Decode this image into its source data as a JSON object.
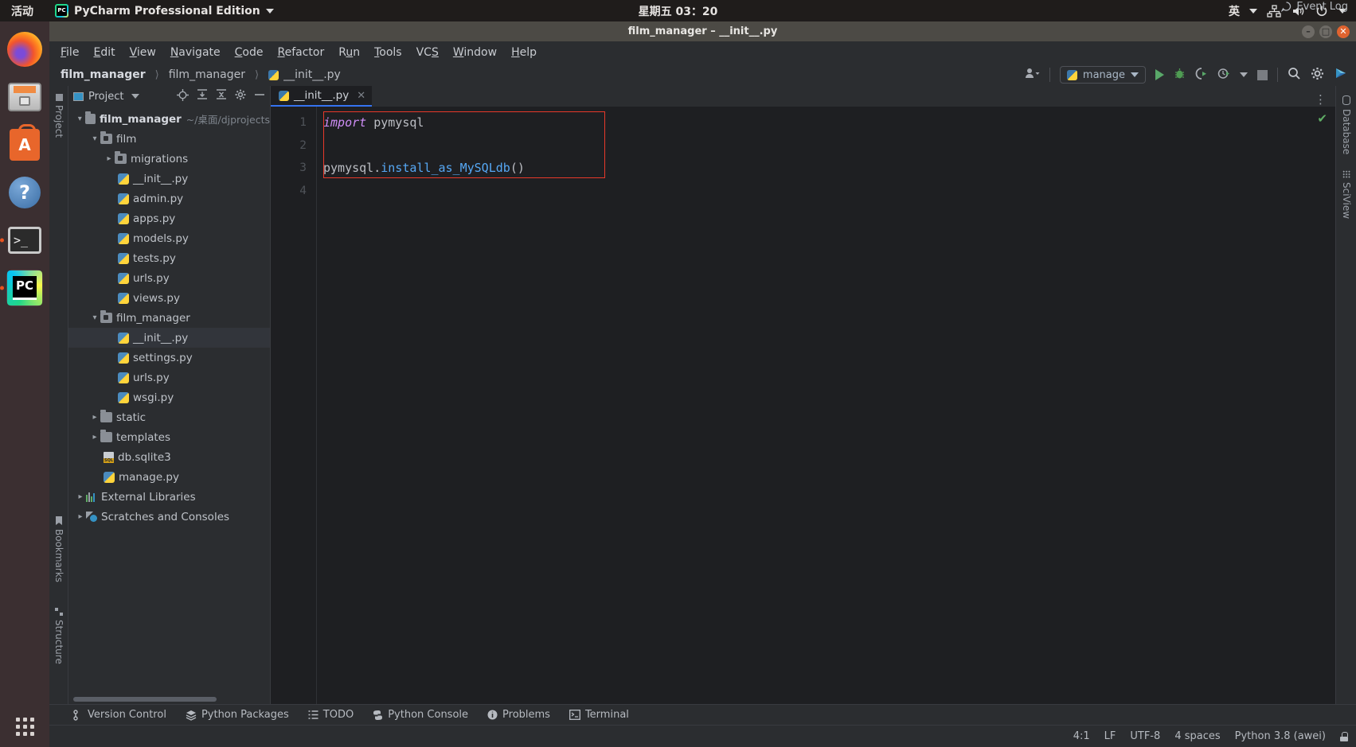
{
  "gnome": {
    "activities": "活动",
    "app_name": "PyCharm Professional Edition",
    "clock": "星期五 03：20",
    "input_method": "英",
    "icons": [
      "network-icon",
      "volume-icon",
      "power-icon"
    ]
  },
  "dock": {
    "items": [
      {
        "name": "firefox",
        "label": "Firefox"
      },
      {
        "name": "files",
        "label": "Files"
      },
      {
        "name": "ubuntu-software",
        "label": "Ubuntu Software"
      },
      {
        "name": "help",
        "label": "Help"
      },
      {
        "name": "terminal",
        "label": "Terminal"
      },
      {
        "name": "pycharm",
        "label": "PyCharm"
      }
    ],
    "show_apps": "show-applications"
  },
  "window": {
    "title": "film_manager – __init__.py",
    "buttons": [
      "minimize",
      "maximize",
      "close"
    ]
  },
  "menu": [
    {
      "label": "File",
      "mnemonic": "F"
    },
    {
      "label": "Edit",
      "mnemonic": "E"
    },
    {
      "label": "View",
      "mnemonic": "V"
    },
    {
      "label": "Navigate",
      "mnemonic": "N"
    },
    {
      "label": "Code",
      "mnemonic": "C"
    },
    {
      "label": "Refactor",
      "mnemonic": "R"
    },
    {
      "label": "Run",
      "mnemonic": "u"
    },
    {
      "label": "Tools",
      "mnemonic": "T"
    },
    {
      "label": "VCS",
      "mnemonic": "S"
    },
    {
      "label": "Window",
      "mnemonic": "W"
    },
    {
      "label": "Help",
      "mnemonic": "H"
    }
  ],
  "navbar": {
    "crumbs": [
      "film_manager",
      "film_manager",
      "__init__.py"
    ],
    "run_config": "manage",
    "actions": [
      "run-button",
      "debug-button",
      "run-coverage-button",
      "profile-button",
      "stop-button",
      "search-everywhere-button",
      "settings-button",
      "updates-button"
    ]
  },
  "project_panel": {
    "title": "Project",
    "toolbar": [
      "locate-icon",
      "expand-all-icon",
      "collapse-all-icon",
      "settings-icon",
      "hide-icon"
    ],
    "tree": [
      {
        "label": "film_manager",
        "path": "~/桌面/djprojects",
        "indent": 0,
        "icon": "folder",
        "chevron": "down",
        "bold": true
      },
      {
        "label": "film",
        "indent": 1,
        "icon": "module-folder",
        "chevron": "down"
      },
      {
        "label": "migrations",
        "indent": 2,
        "icon": "module-folder",
        "chevron": "right"
      },
      {
        "label": "__init__.py",
        "indent": 3,
        "icon": "python-file"
      },
      {
        "label": "admin.py",
        "indent": 3,
        "icon": "python-file"
      },
      {
        "label": "apps.py",
        "indent": 3,
        "icon": "python-file"
      },
      {
        "label": "models.py",
        "indent": 3,
        "icon": "python-file"
      },
      {
        "label": "tests.py",
        "indent": 3,
        "icon": "python-file"
      },
      {
        "label": "urls.py",
        "indent": 3,
        "icon": "python-file"
      },
      {
        "label": "views.py",
        "indent": 3,
        "icon": "python-file"
      },
      {
        "label": "film_manager",
        "indent": 1,
        "icon": "module-folder",
        "chevron": "down"
      },
      {
        "label": "__init__.py",
        "indent": 3,
        "icon": "python-file",
        "selected": true
      },
      {
        "label": "settings.py",
        "indent": 3,
        "icon": "python-file"
      },
      {
        "label": "urls.py",
        "indent": 3,
        "icon": "python-file"
      },
      {
        "label": "wsgi.py",
        "indent": 3,
        "icon": "python-file"
      },
      {
        "label": "static",
        "indent": 1,
        "icon": "folder",
        "chevron": "right"
      },
      {
        "label": "templates",
        "indent": 1,
        "icon": "folder",
        "chevron": "right"
      },
      {
        "label": "db.sqlite3",
        "indent": 2,
        "icon": "sql-file"
      },
      {
        "label": "manage.py",
        "indent": 2,
        "icon": "python-file"
      },
      {
        "label": "External Libraries",
        "indent": 0,
        "icon": "library",
        "chevron": "right"
      },
      {
        "label": "Scratches and Consoles",
        "indent": 0,
        "icon": "scratches",
        "chevron": "right"
      }
    ]
  },
  "left_tool_tabs": [
    {
      "label": "Project",
      "icon": "project-icon"
    },
    {
      "label": "Bookmarks",
      "icon": "bookmark-icon"
    },
    {
      "label": "Structure",
      "icon": "structure-icon"
    }
  ],
  "right_tool_tabs": [
    {
      "label": "Database",
      "icon": "database-icon"
    },
    {
      "label": "SciView",
      "icon": "sciview-icon"
    }
  ],
  "editor": {
    "tab": "__init__.py",
    "lines": [
      "1",
      "2",
      "3",
      "4"
    ],
    "code": [
      {
        "tokens": [
          {
            "t": "import",
            "c": "kw"
          },
          {
            "t": " pymysql",
            "c": ""
          }
        ]
      },
      {
        "tokens": [
          {
            "t": "",
            "c": ""
          }
        ]
      },
      {
        "tokens": [
          {
            "t": "pymysql.",
            "c": ""
          },
          {
            "t": "install_as_MySQLdb",
            "c": "fn"
          },
          {
            "t": "()",
            "c": ""
          }
        ]
      },
      {
        "tokens": [
          {
            "t": "",
            "c": ""
          }
        ]
      }
    ],
    "highlight_color": "#e8392a",
    "inspection_status": "ok-check"
  },
  "bottom_tool_tabs": [
    {
      "label": "Version Control",
      "icon": "branch-icon"
    },
    {
      "label": "Python Packages",
      "icon": "packages-icon"
    },
    {
      "label": "TODO",
      "icon": "todo-icon"
    },
    {
      "label": "Python Console",
      "icon": "python-icon"
    },
    {
      "label": "Problems",
      "icon": "problems-icon"
    },
    {
      "label": "Terminal",
      "icon": "terminal-icon"
    }
  ],
  "status_bar": {
    "event_log": "Event Log",
    "caret": "4:1",
    "line_separator": "LF",
    "encoding": "UTF-8",
    "indent": "4 spaces",
    "interpreter": "Python 3.8 (awei)",
    "lock": "read-only-toggle"
  },
  "colors": {
    "accent": "#3573f0",
    "error": "#e8392a",
    "ok": "#5fad65",
    "bg": "#2b2d30",
    "editor_bg": "#1e1f22"
  }
}
